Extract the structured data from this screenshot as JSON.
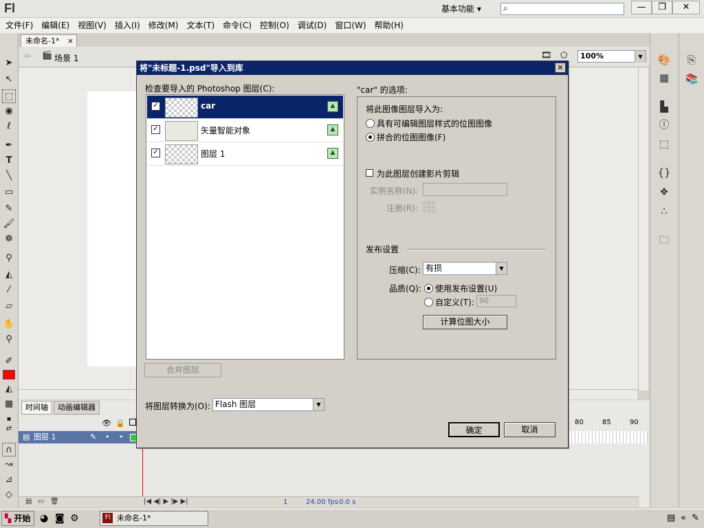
{
  "app": {
    "logo": "Fl",
    "workspace": "基本功能 ▾",
    "search_placeholder": ""
  },
  "window_controls": [
    "—",
    "❐",
    "✕"
  ],
  "menu": [
    "文件(F)",
    "编辑(E)",
    "视图(V)",
    "插入(I)",
    "修改(M)",
    "文本(T)",
    "命令(C)",
    "控制(O)",
    "调试(D)",
    "窗口(W)",
    "帮助(H)"
  ],
  "document": {
    "tab_label": "未命名-1*",
    "tab_close": "×",
    "scene_label": "场景 1",
    "zoom": "100%"
  },
  "timeline": {
    "tabs": [
      "时间轴",
      "动画编辑器"
    ],
    "layer_name": "图层 1",
    "frame_numbers": [
      "80",
      "85",
      "90"
    ],
    "current_frame": "1",
    "fps": "24.00 fps",
    "time": "0.0 s"
  },
  "dialog": {
    "title": "将\"未标题-1.psd\"导入到库",
    "close": "✕",
    "layers_label": "检查要导入的 Photoshop 图层(C):",
    "layers": [
      {
        "name": "car",
        "checked": true,
        "selected": true
      },
      {
        "name": "矢量智能对象",
        "checked": true,
        "selected": false
      },
      {
        "name": "图层 1",
        "checked": true,
        "selected": false
      }
    ],
    "merge_button": "合并图层",
    "convert_label": "将图层转换为(O):",
    "convert_value": "Flash 图层",
    "options_title": "\"car\" 的选项:",
    "import_as_label": "将此图像图层导入为:",
    "import_options": [
      {
        "label": "具有可编辑图层样式的位图图像",
        "selected": false
      },
      {
        "label": "拼合的位图图像(F)",
        "selected": true
      }
    ],
    "movieclip_label": "为此图层创建影片剪辑",
    "instance_name_label": "实例名称(N):",
    "registration_label": "注册(R):",
    "publish_section": "发布设置",
    "compression_label": "压缩(C):",
    "compression_value": "有损",
    "quality_label": "品质(Q):",
    "quality_options": [
      {
        "label": "使用发布设置(U)",
        "selected": true
      },
      {
        "label": "自定义(T):",
        "selected": false
      }
    ],
    "custom_quality_value": "90",
    "calc_button": "计算位图大小",
    "ok_button": "确定",
    "cancel_button": "取消"
  },
  "taskbar": {
    "start": "开始",
    "task": "未命名-1*"
  }
}
